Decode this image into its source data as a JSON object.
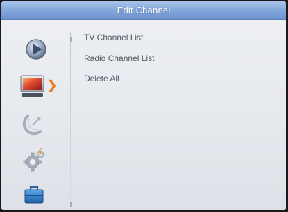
{
  "header": {
    "title": "Edit Channel"
  },
  "sidebar": {
    "items": [
      {
        "icon": "play-icon",
        "selected": false
      },
      {
        "icon": "tv-icon",
        "selected": true
      },
      {
        "icon": "satellite-dish-icon",
        "selected": false
      },
      {
        "icon": "settings-gear-icon",
        "selected": false
      },
      {
        "icon": "toolbox-icon",
        "selected": false
      }
    ]
  },
  "menu": {
    "items": [
      {
        "label": "TV Channel List"
      },
      {
        "label": "Radio Channel List"
      },
      {
        "label": "Delete All"
      }
    ]
  },
  "colors": {
    "title_bar": "#86a9dc",
    "background": "#e9ecf0",
    "menu_text": "#505863",
    "selection_arrow": "#f07a1e"
  }
}
